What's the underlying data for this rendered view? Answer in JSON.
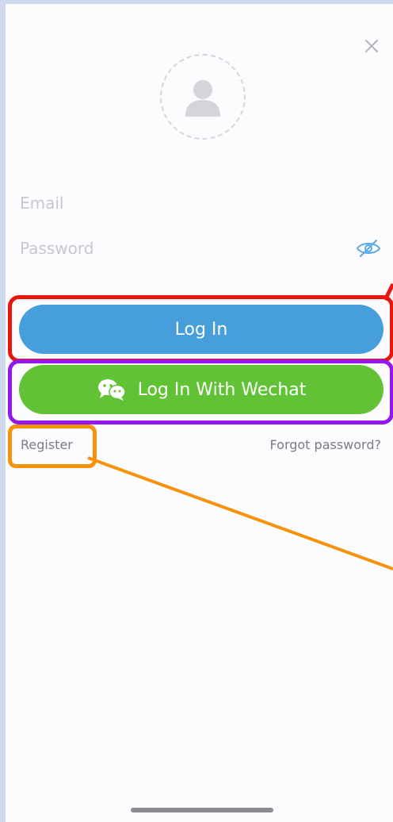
{
  "login_form": {
    "close_icon": "close-icon",
    "avatar_icon": "user-avatar-placeholder-icon",
    "email": {
      "placeholder": "Email",
      "value": ""
    },
    "password": {
      "placeholder": "Password",
      "value": "",
      "toggle_icon": "eye-slash-icon"
    },
    "login_label": "Log In",
    "wechat_label": "Log In With Wechat",
    "wechat_icon": "wechat-icon",
    "register_label": "Register",
    "forgot_label": "Forgot password?"
  },
  "colors": {
    "login_button": "#469edb",
    "wechat_button": "#62c236",
    "highlight_red": "#e8160c",
    "highlight_purple": "#9317ee",
    "highlight_orange": "#f5930c"
  }
}
